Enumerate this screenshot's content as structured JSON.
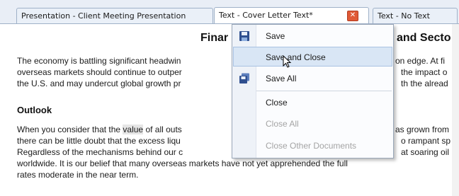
{
  "tabs": [
    {
      "label": "Presentation - Client Meeting Presentation"
    },
    {
      "label": "Text - Cover Letter Text*"
    },
    {
      "label": "Text - No Text"
    }
  ],
  "document": {
    "title_left": "Finar",
    "title_right": "and Secto",
    "para1": [
      [
        "The economy is battling significant headwin",
        "on edge. At fi"
      ],
      [
        "overseas markets should continue to outper",
        "the impact o"
      ],
      [
        "the U.S. and may undercut global growth pr",
        "th the alread"
      ]
    ],
    "heading": "Outlook",
    "para2": {
      "l1_a": "When you consider that the ",
      "l1_hl": "value",
      "l1_b": " of all outs",
      "l1_r": "as grown from",
      "l2_a": "there can be little doubt that the excess liqu",
      "l2_r": "o rampant sp",
      "l3_a": "Regardless of the mechanisms behind our c",
      "l3_r": "at soaring oil",
      "l4": "worldwide. It is our belief that many overseas markets have not yet apprehended the full",
      "l5": "rates moderate in the near term."
    }
  },
  "menu": {
    "items": [
      {
        "label": "Save",
        "icon": "save-icon"
      },
      {
        "label": "Save and Close"
      },
      {
        "label": "Save All",
        "icon": "save-all-icon"
      },
      {
        "label": "Close"
      },
      {
        "label": "Close All"
      },
      {
        "label": "Close Other Documents"
      }
    ]
  }
}
